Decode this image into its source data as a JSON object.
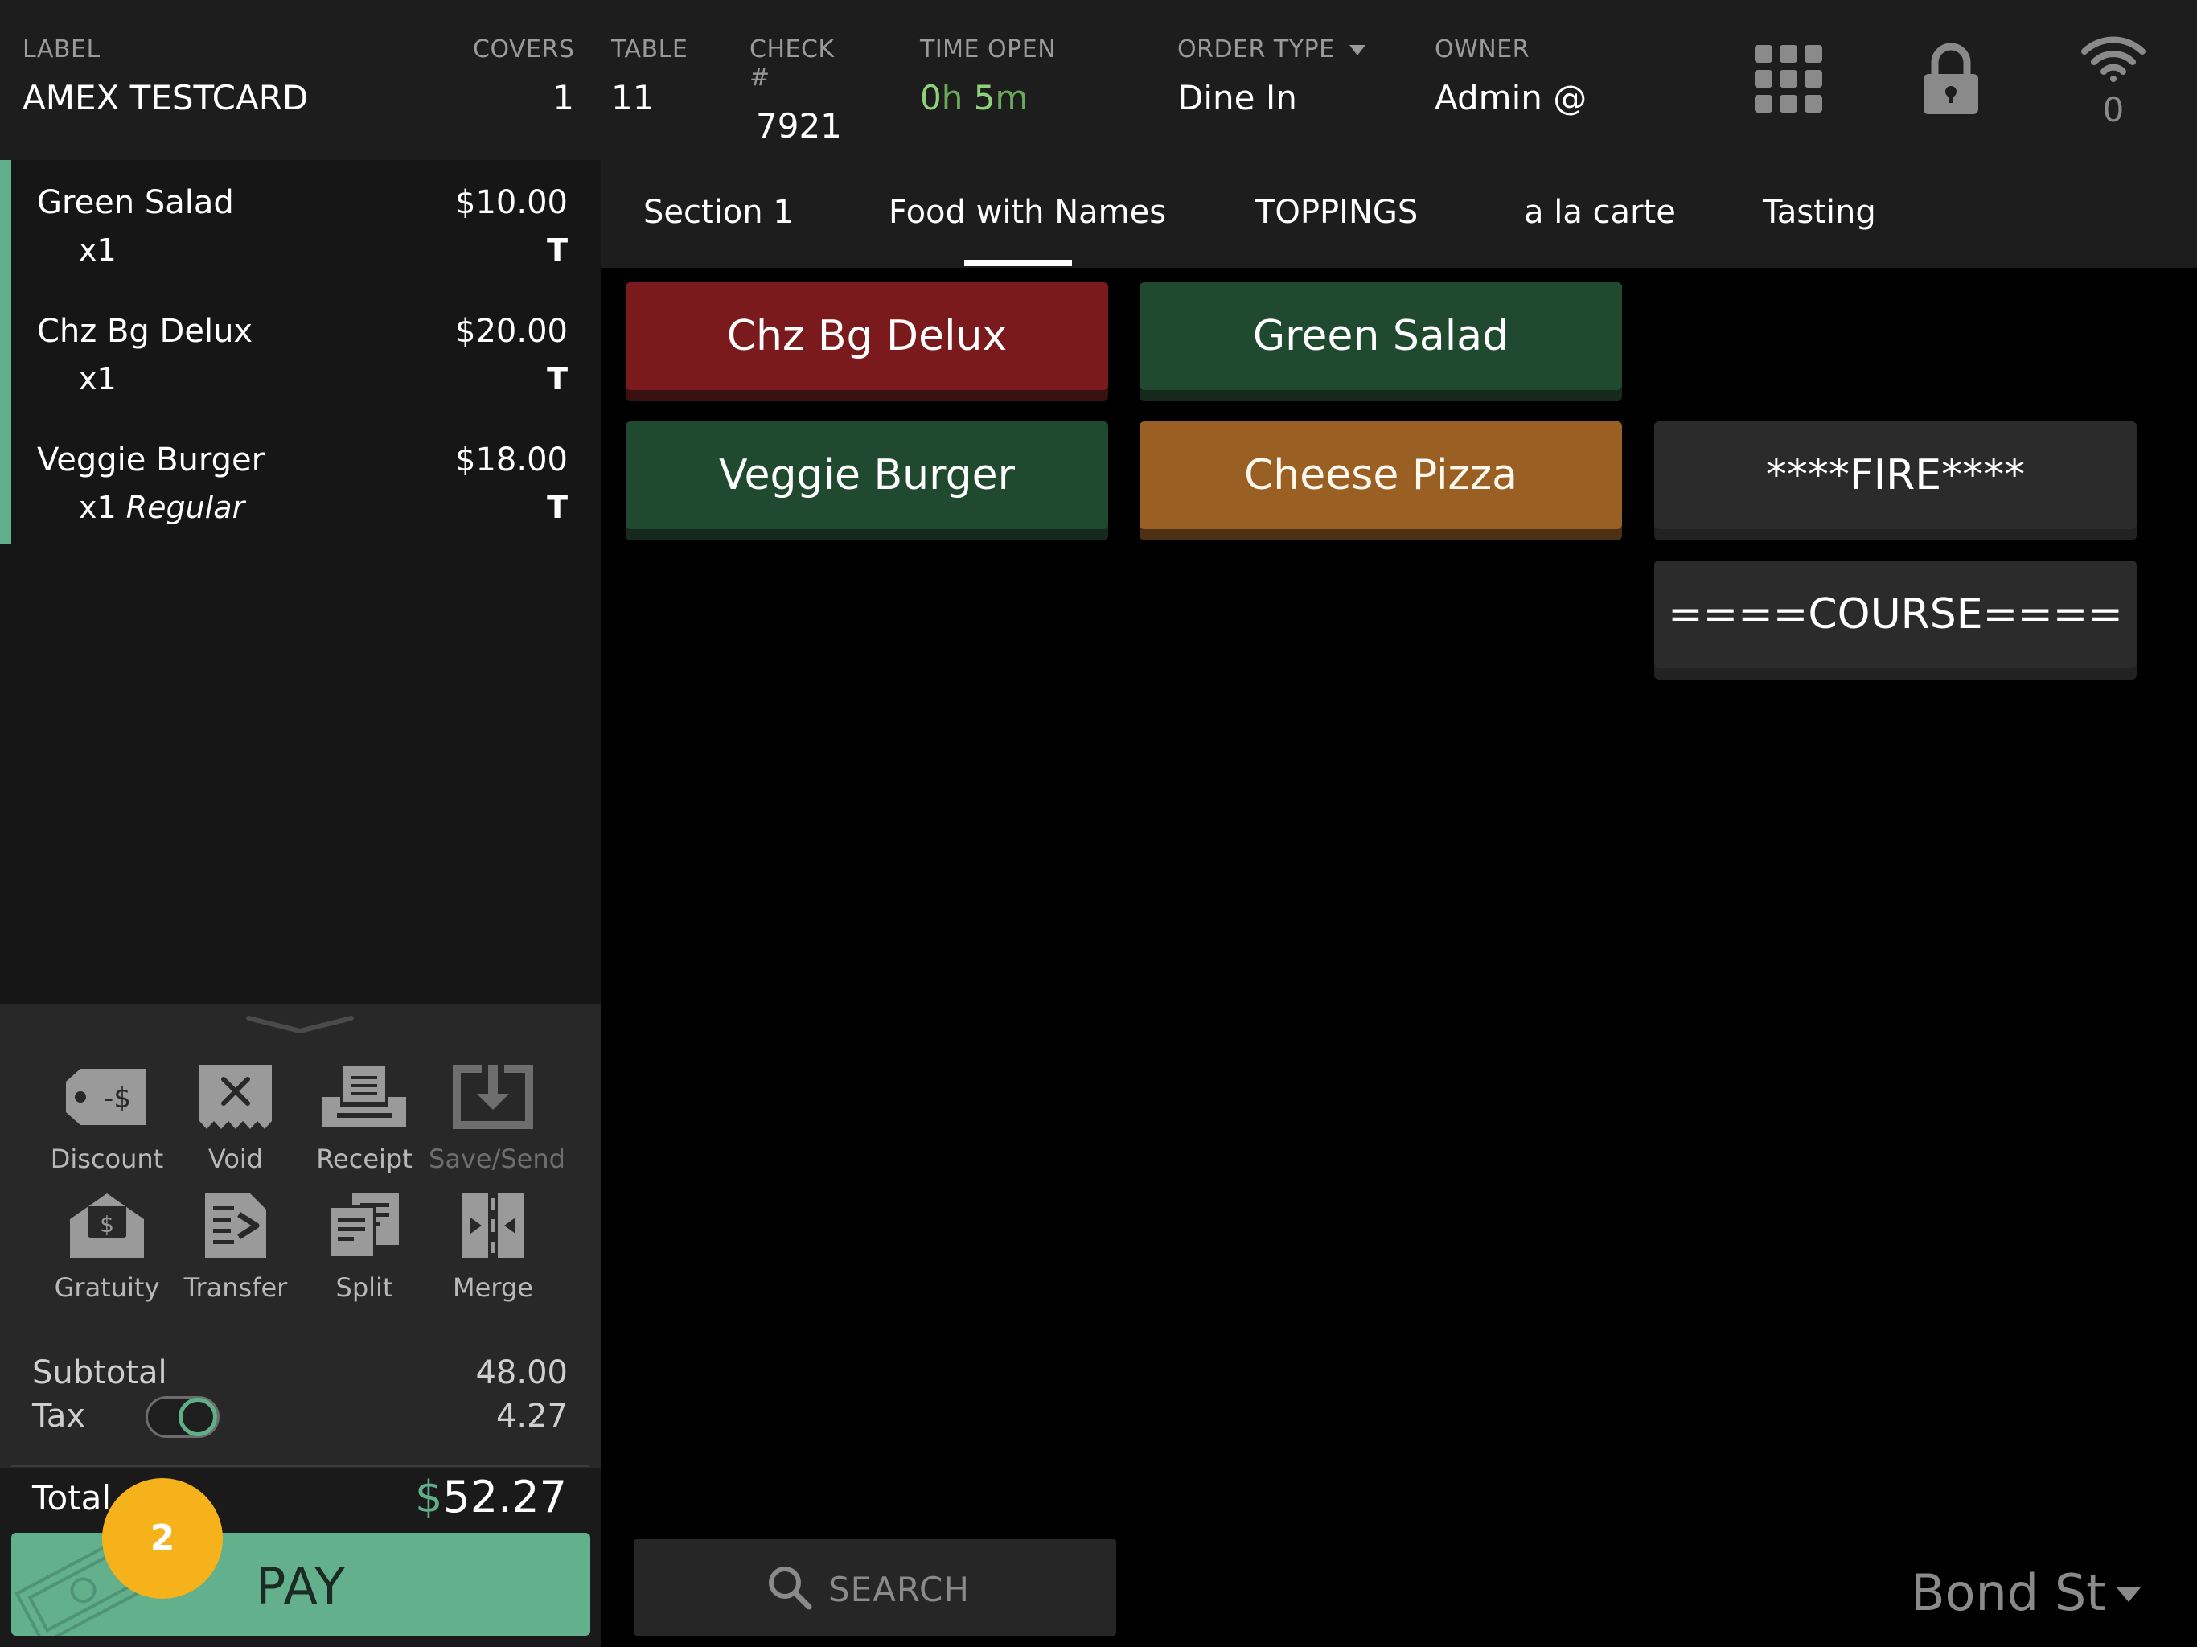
{
  "header": {
    "label": {
      "title": "LABEL",
      "value": "AMEX TESTCARD"
    },
    "covers": {
      "title": "COVERS",
      "value": "1"
    },
    "table": {
      "title": "TABLE",
      "value": "11"
    },
    "check": {
      "title": "CHECK #",
      "value": "7921"
    },
    "time_open": {
      "title": "TIME OPEN",
      "hours": "0",
      "hours_unit": "h",
      "minutes": "5",
      "minutes_unit": "m"
    },
    "order_type": {
      "title": "ORDER TYPE",
      "value": "Dine In"
    },
    "owner": {
      "title": "OWNER",
      "value": "Admin @"
    },
    "wifi_count": "0",
    "icons": [
      "grid-icon",
      "lock-icon",
      "wifi-icon"
    ]
  },
  "order": {
    "items": [
      {
        "name": "Green Salad",
        "price": "$10.00",
        "qty": "x1",
        "modifier": "",
        "tax_flag": "T"
      },
      {
        "name": "Chz Bg Delux",
        "price": "$20.00",
        "qty": "x1",
        "modifier": "",
        "tax_flag": "T"
      },
      {
        "name": "Veggie Burger",
        "price": "$18.00",
        "qty": "x1",
        "modifier": "Regular",
        "tax_flag": "T"
      }
    ]
  },
  "actions": {
    "discount": "Discount",
    "void": "Void",
    "receipt": "Receipt",
    "save_send": "Save/Send",
    "gratuity": "Gratuity",
    "transfer": "Transfer",
    "split": "Split",
    "merge": "Merge"
  },
  "totals": {
    "subtotal_label": "Subtotal",
    "subtotal": "48.00",
    "tax_label": "Tax",
    "tax": "4.27",
    "tax_enabled": true,
    "total_label": "Total",
    "currency": "$",
    "total": "52.27"
  },
  "pay": {
    "label": "PAY",
    "badge": "2"
  },
  "tabs": [
    "Section 1",
    "Food with Names",
    "TOPPINGS",
    "a la carte",
    "Tasting"
  ],
  "active_tab": "Food with Names",
  "menu": {
    "chz_bg_delux": "Chz Bg Delux",
    "green_salad": "Green Salad",
    "veggie_burger": "Veggie Burger",
    "cheese_pizza": "Cheese Pizza",
    "fire": "****FIRE****",
    "course": "====COURSE===="
  },
  "search": {
    "placeholder": "SEARCH"
  },
  "location": "Bond St",
  "colors": {
    "accent_green": "#63b08d",
    "badge_orange": "#f6b21b",
    "button_red": "#7a1a1c",
    "button_green": "#1f4a2f",
    "button_orange": "#9a5f22",
    "time_green": "#8fd07a"
  }
}
